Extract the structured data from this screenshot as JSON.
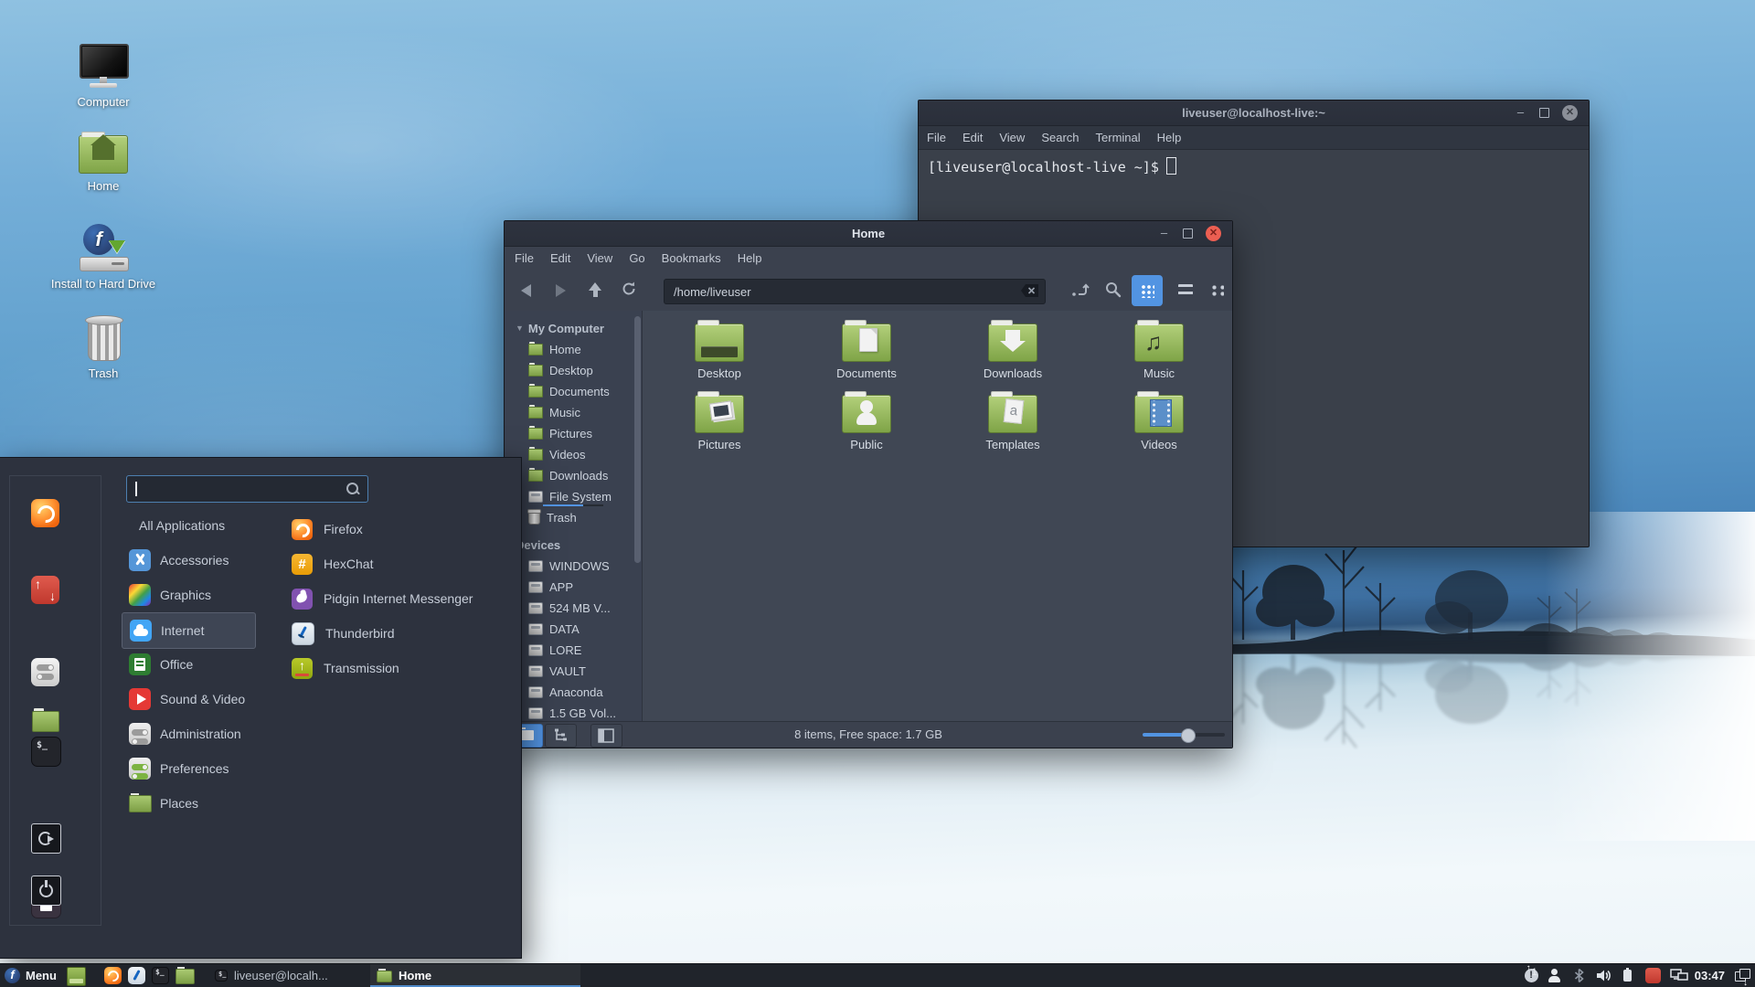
{
  "colors": {
    "accent": "#5294e2",
    "close_button": "#ec5f52",
    "folder_green": "#8fb454",
    "panel_bg": "#20242b",
    "menu_bg": "#2d323e",
    "window_bg": "#404754"
  },
  "desktop": {
    "icons": [
      {
        "label": "Computer"
      },
      {
        "label": "Home"
      },
      {
        "label": "Install to Hard Drive"
      },
      {
        "label": "Trash"
      }
    ]
  },
  "terminal": {
    "title": "liveuser@localhost-live:~",
    "menu": [
      "File",
      "Edit",
      "View",
      "Search",
      "Terminal",
      "Help"
    ],
    "prompt": "[liveuser@localhost-live ~]$"
  },
  "file_manager": {
    "title": "Home",
    "menu": [
      "File",
      "Edit",
      "View",
      "Go",
      "Bookmarks",
      "Help"
    ],
    "path": "/home/liveuser",
    "sidebar": {
      "my_computer_label": "My Computer",
      "places": [
        "Home",
        "Desktop",
        "Documents",
        "Music",
        "Pictures",
        "Videos",
        "Downloads",
        "File System",
        "Trash"
      ],
      "devices_label": "Devices",
      "devices": [
        "WINDOWS",
        "APP",
        "524 MB V...",
        "DATA",
        "LORE",
        "VAULT",
        "Anaconda",
        "1.5 GB Vol..."
      ]
    },
    "folders": [
      {
        "label": "Desktop"
      },
      {
        "label": "Documents"
      },
      {
        "label": "Downloads"
      },
      {
        "label": "Music"
      },
      {
        "label": "Pictures"
      },
      {
        "label": "Public"
      },
      {
        "label": "Templates"
      },
      {
        "label": "Videos"
      }
    ],
    "status": "8 items, Free space: 1.7 GB"
  },
  "menu": {
    "search_value": "",
    "categories": [
      "All Applications",
      "Accessories",
      "Graphics",
      "Internet",
      "Office",
      "Sound & Video",
      "Administration",
      "Preferences",
      "Places"
    ],
    "selected_category": "Internet",
    "apps": [
      "Firefox",
      "HexChat",
      "Pidgin Internet Messenger",
      "Thunderbird",
      "Transmission"
    ]
  },
  "taskbar": {
    "menu_label": "Menu",
    "windows": [
      {
        "label": "liveuser@localh...",
        "active": false
      },
      {
        "label": "Home",
        "active": true
      }
    ],
    "notification_count": "1",
    "clock": "03:47"
  }
}
